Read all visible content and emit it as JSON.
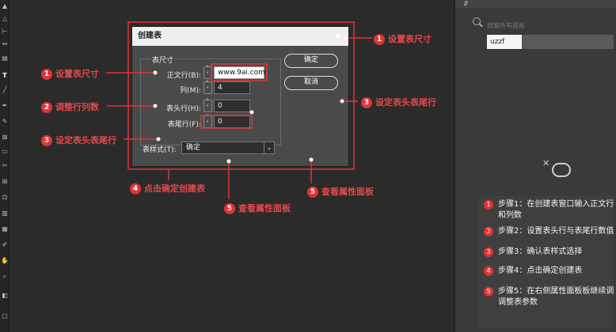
{
  "dialog": {
    "title": "创建表",
    "group_label": "表尺寸",
    "body_rows_label": "正文行(B):",
    "body_rows_value": "www.9ai.com",
    "columns_label": "列(M):",
    "columns_value": "4",
    "header_rows_label": "表头行(H):",
    "header_rows_value": "0",
    "footer_rows_label": "表尾行(F):",
    "footer_rows_value": "0",
    "ok_label": "确定",
    "cancel_label": "取消",
    "style_label": "表样式(T):",
    "style_value": "确定"
  },
  "right_panel": {
    "search_placeholder": "搜索所有面板",
    "input_value": "uzzf"
  },
  "annotations": {
    "a1_right": {
      "num": "1",
      "text": "设置表尺寸"
    },
    "a1_left": {
      "num": "1",
      "text": "设置表尺寸"
    },
    "a2_left": {
      "num": "2",
      "text": "调整行列数"
    },
    "a3_left": {
      "num": "3",
      "text": "设定表头表尾行"
    },
    "a3_right": {
      "num": "3",
      "text": "设定表头表尾行"
    },
    "a4": {
      "num": "4",
      "text": "点击确定创建表"
    },
    "a5_mid": {
      "num": "5",
      "text": "查看属性面板"
    },
    "a5_right": {
      "num": "5",
      "text": "查看属性面板"
    }
  },
  "steps": [
    {
      "num": "1",
      "text": "步骤1：在创建表窗口输入正文行和列数"
    },
    {
      "num": "2",
      "text": "步骤2：设置表头行与表尾行数值"
    },
    {
      "num": "3",
      "text": "步骤3：确认表样式选择"
    },
    {
      "num": "4",
      "text": "步骤4：点击确定创建表"
    },
    {
      "num": "5",
      "text": "步骤5：在右侧属性面板板继续调调整表参数"
    }
  ],
  "colors": {
    "accent_red": "#e03434",
    "dialog_bg": "#4a4a4a",
    "panel_bg": "#3a3a3a"
  }
}
